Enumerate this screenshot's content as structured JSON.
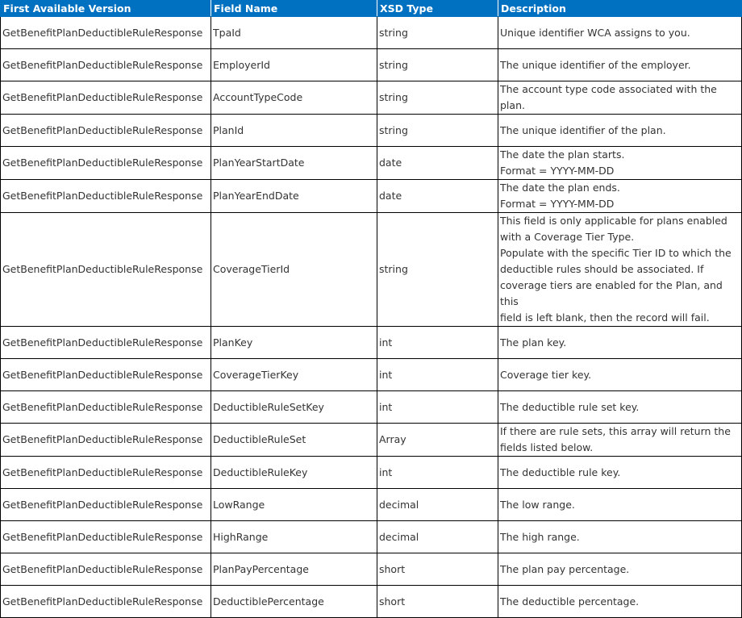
{
  "header": {
    "col1": "First Available Version",
    "col2": "Field Name",
    "col3": "XSD Type",
    "col4": "Description"
  },
  "rows": [
    {
      "version": "GetBenefitPlanDeductibleRuleResponse",
      "field": "TpaId",
      "type": "string",
      "desc": [
        "Unique identifier WCA assigns to you."
      ]
    },
    {
      "version": "GetBenefitPlanDeductibleRuleResponse",
      "field": "EmployerId",
      "type": "string",
      "desc": [
        "The unique identifier of the employer."
      ]
    },
    {
      "version": "GetBenefitPlanDeductibleRuleResponse",
      "field": "AccountTypeCode",
      "type": "string",
      "desc": [
        "The account type code associated with the plan."
      ]
    },
    {
      "version": "GetBenefitPlanDeductibleRuleResponse",
      "field": "PlanId",
      "type": "string",
      "desc": [
        "The unique identifier of the plan."
      ]
    },
    {
      "version": "GetBenefitPlanDeductibleRuleResponse",
      "field": "PlanYearStartDate",
      "type": "date",
      "desc": [
        "The date the plan starts.",
        "Format = YYYY-MM-DD"
      ]
    },
    {
      "version": "GetBenefitPlanDeductibleRuleResponse",
      "field": "PlanYearEndDate",
      "type": "date",
      "desc": [
        "The date the plan ends.",
        "Format = YYYY-MM-DD"
      ]
    },
    {
      "version": "GetBenefitPlanDeductibleRuleResponse",
      "field": "CoverageTierId",
      "type": "string",
      "desc": [
        "This field is only applicable for plans enabled",
        "with a Coverage Tier Type.",
        "Populate with the specific Tier ID to which the",
        "deductible rules should be associated. If",
        "coverage tiers are enabled for the Plan, and this",
        "field is left blank, then the record will fail."
      ]
    },
    {
      "version": "GetBenefitPlanDeductibleRuleResponse",
      "field": "PlanKey",
      "type": "int",
      "desc": [
        "The plan key."
      ]
    },
    {
      "version": "GetBenefitPlanDeductibleRuleResponse",
      "field": "CoverageTierKey",
      "type": "int",
      "desc": [
        "Coverage tier key."
      ]
    },
    {
      "version": "GetBenefitPlanDeductibleRuleResponse",
      "field": "DeductibleRuleSetKey",
      "type": "int",
      "desc": [
        "The deductible rule set key."
      ]
    },
    {
      "version": "GetBenefitPlanDeductibleRuleResponse",
      "field": "DeductibleRuleSet",
      "type": "Array",
      "desc": [
        "If there are rule sets, this array will return the",
        "fields listed below."
      ]
    },
    {
      "version": "GetBenefitPlanDeductibleRuleResponse",
      "field": "DeductibleRuleKey",
      "type": "int",
      "desc": [
        "The deductible rule key."
      ]
    },
    {
      "version": "GetBenefitPlanDeductibleRuleResponse",
      "field": "LowRange",
      "type": "decimal",
      "desc": [
        "The low range."
      ]
    },
    {
      "version": "GetBenefitPlanDeductibleRuleResponse",
      "field": "HighRange",
      "type": "decimal",
      "desc": [
        "The high range."
      ]
    },
    {
      "version": "GetBenefitPlanDeductibleRuleResponse",
      "field": "PlanPayPercentage",
      "type": "short",
      "desc": [
        "The plan pay percentage."
      ]
    },
    {
      "version": "GetBenefitPlanDeductibleRuleResponse",
      "field": "DeductiblePercentage",
      "type": "short",
      "desc": [
        "The deductible percentage."
      ]
    }
  ]
}
